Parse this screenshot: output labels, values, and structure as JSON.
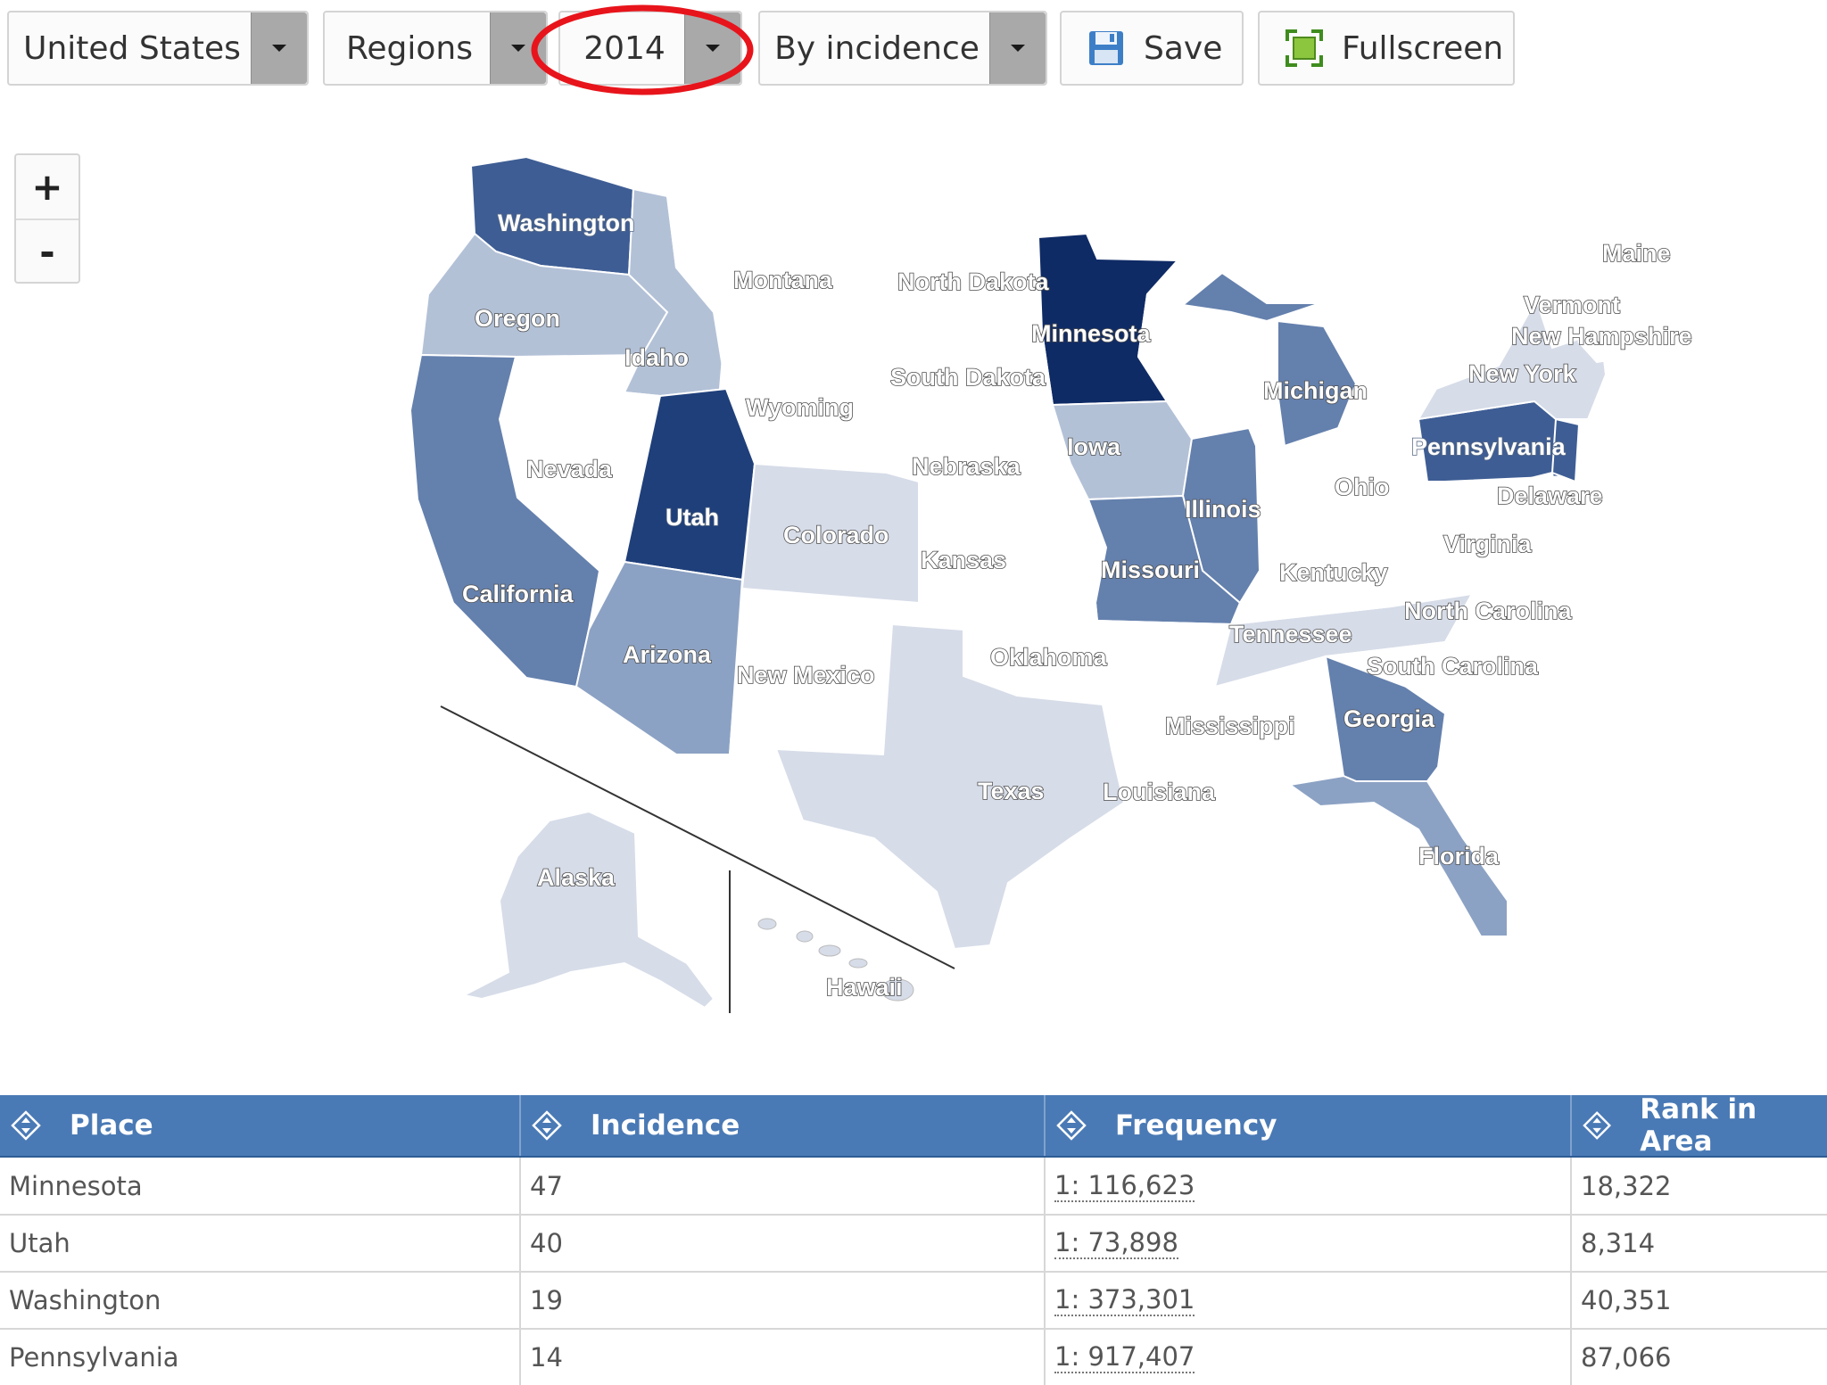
{
  "toolbar": {
    "country": "United States",
    "level": "Regions",
    "year": "2014",
    "mode": "By incidence",
    "save": "Save",
    "fullscreen": "Fullscreen"
  },
  "zoom": {
    "in": "+",
    "out": "-"
  },
  "colors": {
    "shade_0": "#ffffff",
    "shade_1": "#d6dce8",
    "shade_2": "#b3c1d7",
    "shade_3": "#8ca2c4",
    "shade_4": "#6480ad",
    "shade_5": "#3e5d94",
    "shade_6": "#1f3f7a",
    "shade_7": "#0f2b66",
    "highlight": "#e8141b",
    "header": "#4a7ab5"
  },
  "map": {
    "states": {
      "washington": "Washington",
      "oregon": "Oregon",
      "idaho": "Idaho",
      "montana": "Montana",
      "north_dakota": "North Dakota",
      "minnesota": "Minnesota",
      "south_dakota": "South Dakota",
      "wyoming": "Wyoming",
      "nevada": "Nevada",
      "utah": "Utah",
      "colorado": "Colorado",
      "nebraska": "Nebraska",
      "iowa": "Iowa",
      "illinois": "Illinois",
      "michigan": "Michigan",
      "california": "California",
      "kansas": "Kansas",
      "missouri": "Missouri",
      "arizona": "Arizona",
      "new_mexico": "New Mexico",
      "oklahoma": "Oklahoma",
      "texas": "Texas",
      "louisiana": "Louisiana",
      "mississippi": "Mississippi",
      "tennessee": "Tennessee",
      "kentucky": "Kentucky",
      "ohio": "Ohio",
      "pennsylvania": "Pennsylvania",
      "new_york": "New York",
      "vermont": "Vermont",
      "new_hampshire": "New Hampshire",
      "maine": "Maine",
      "delaware": "Delaware",
      "virginia": "Virginia",
      "north_carolina": "North Carolina",
      "south_carolina": "South Carolina",
      "georgia": "Georgia",
      "florida": "Florida",
      "alaska": "Alaska",
      "hawaii": "Hawaii"
    }
  },
  "table": {
    "headers": [
      "Place",
      "Incidence",
      "Frequency",
      "Rank in Area"
    ],
    "rows": [
      [
        "Minnesota",
        "47",
        "1: 116,623",
        "18,322"
      ],
      [
        "Utah",
        "40",
        "1: 73,898",
        "8,314"
      ],
      [
        "Washington",
        "19",
        "1: 373,301",
        "40,351"
      ],
      [
        "Pennsylvania",
        "14",
        "1: 917,407",
        "87,066"
      ]
    ]
  }
}
